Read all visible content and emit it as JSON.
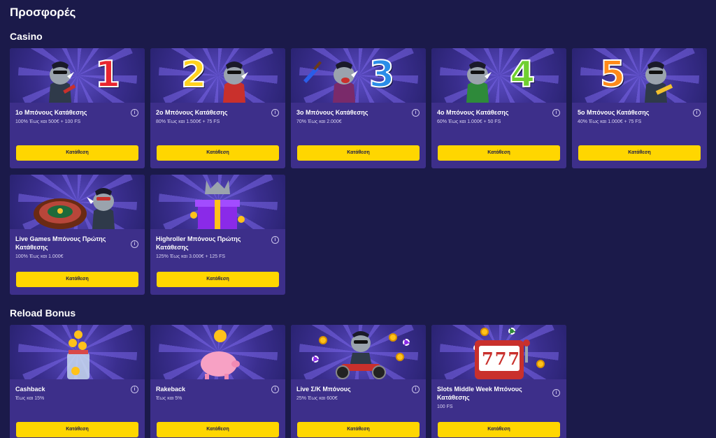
{
  "page": {
    "title": "Προσφορές"
  },
  "sections": {
    "casino": {
      "title": "Casino"
    },
    "reload": {
      "title": "Reload Bonus"
    }
  },
  "colors": {
    "background": "#1b1a4a",
    "card": "#3d2f8a",
    "button": "#ffd600",
    "button_text": "#1b1a4a"
  },
  "casino_cards": [
    {
      "title": "1ο Μπόνους Κατάθεσης",
      "subtitle": "100% Έως και 500€ + 100 FS",
      "button": "Κατάθεση",
      "art_number": "1",
      "art_number_color": "#e8252f"
    },
    {
      "title": "2ο Μπόνους Κατάθεσης",
      "subtitle": "80% Έως και 1.500€ + 75 FS",
      "button": "Κατάθεση",
      "art_number": "2",
      "art_number_color": "#ffd21e"
    },
    {
      "title": "3ο Μπόνους Κατάθεσης",
      "subtitle": "70% Έως και 2.000€",
      "button": "Κατάθεση",
      "art_number": "3",
      "art_number_color": "#2a8de8"
    },
    {
      "title": "4ο Μπόνους Κατάθεσης",
      "subtitle": "60% Έως και 1.000€ + 50 FS",
      "button": "Κατάθεση",
      "art_number": "4",
      "art_number_color": "#6fcf2f"
    },
    {
      "title": "5ο Μπόνους Κατάθεσης",
      "subtitle": "40% Έως και 1.000€ + 75 FS",
      "button": "Κατάθεση",
      "art_number": "5",
      "art_number_color": "#ff8a1a"
    },
    {
      "title": "Live Games Μπόνους Πρώτης Κατάθεσης",
      "subtitle": "100% Έως και 1.000€",
      "button": "Κατάθεση"
    },
    {
      "title": "Highroller Μπόνους Πρώτης Κατάθεσης",
      "subtitle": "125% Έως και 3.000€ + 125 FS",
      "button": "Κατάθεση"
    }
  ],
  "reload_cards": [
    {
      "title": "Cashback",
      "subtitle": "Έως και 15%",
      "button": "Κατάθεση"
    },
    {
      "title": "Rakeback",
      "subtitle": "Έως και 5%",
      "button": "Κατάθεση"
    },
    {
      "title": "Live Σ/Κ Μπόνους",
      "subtitle": "25% Έως και 600€",
      "button": "Κατάθεση"
    },
    {
      "title": "Slots Middle Week Μπόνους Κατάθεσης",
      "subtitle": "100 FS",
      "button": "Κατάθεση",
      "slot_digits": "777"
    }
  ],
  "icons": {
    "info": "info-icon",
    "mascot": "rhino-mascot"
  },
  "info_glyph": "i"
}
